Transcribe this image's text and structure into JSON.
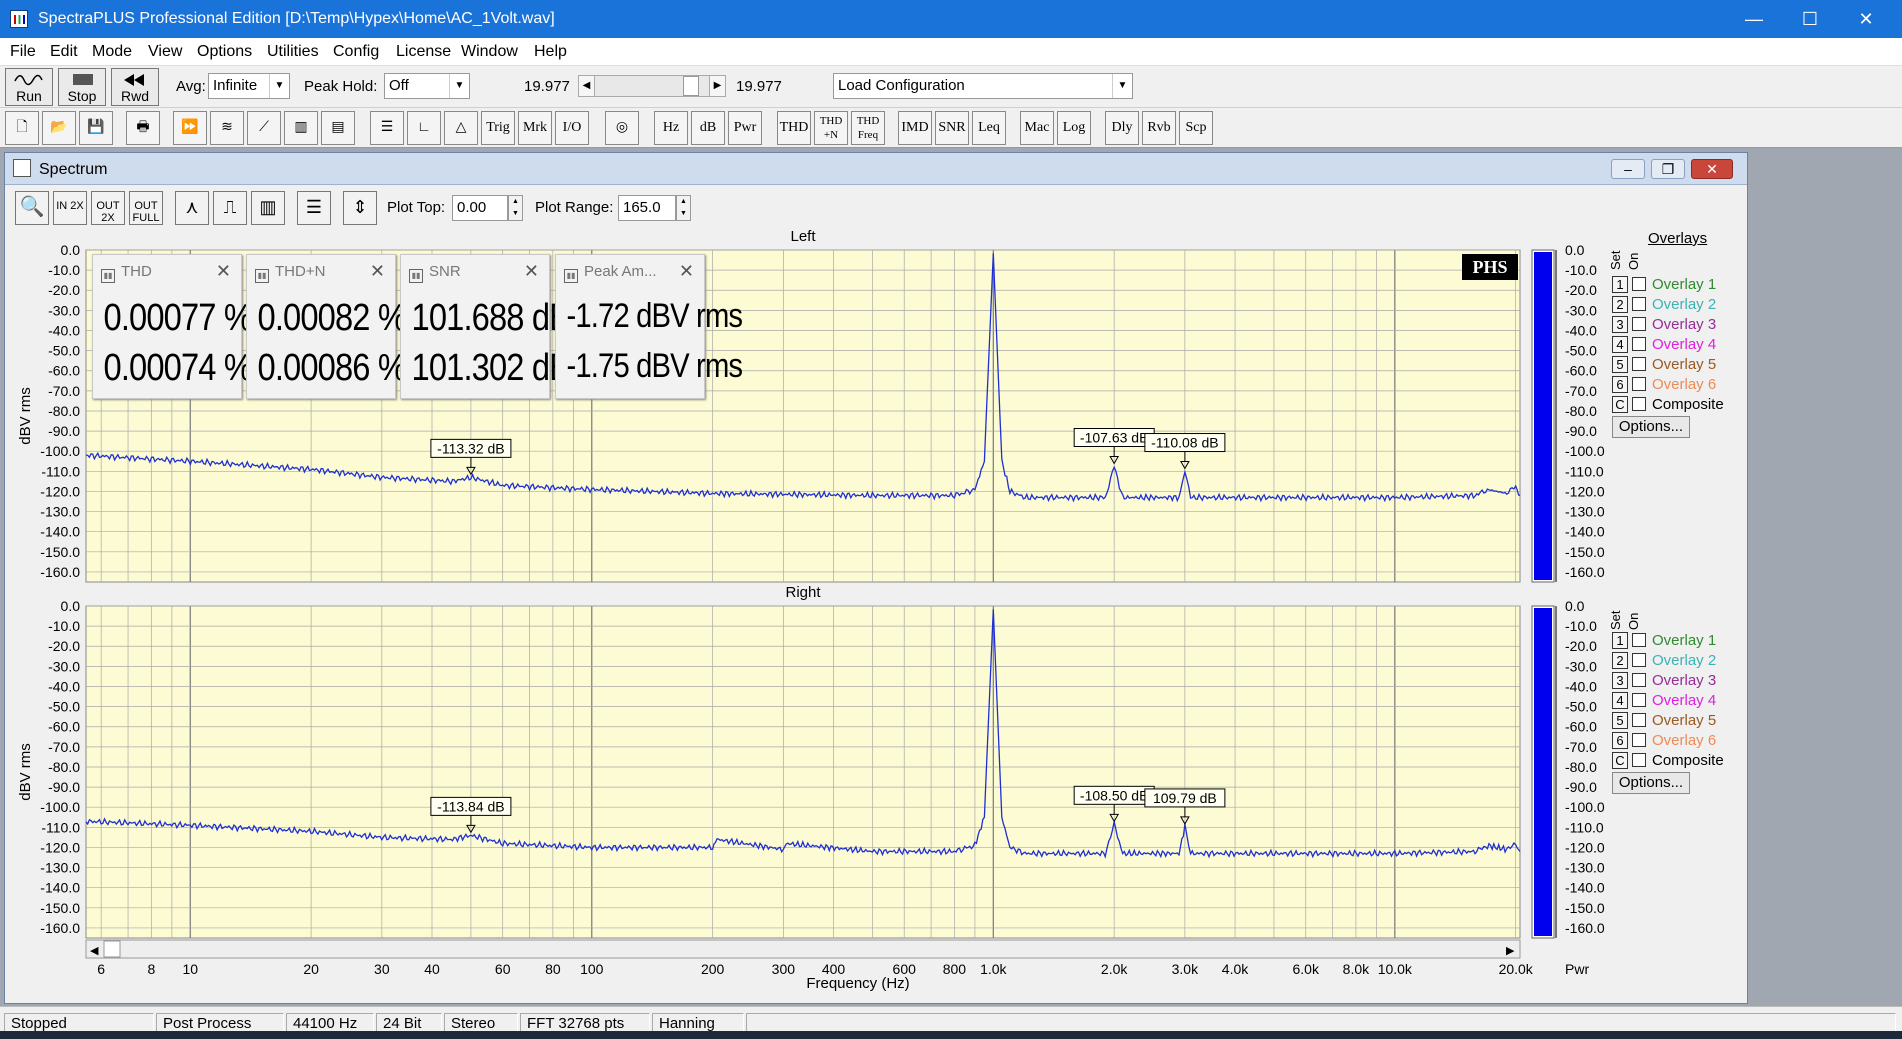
{
  "window": {
    "title": "SpectraPLUS Professional Edition [D:\\Temp\\Hypex\\Home\\AC_1Volt.wav]",
    "min": "—",
    "max": "☐",
    "close": "✕"
  },
  "menu": [
    "File",
    "Edit",
    "Mode",
    "View",
    "Options",
    "Utilities",
    "Config",
    "License",
    "Window",
    "Help"
  ],
  "toolbar1": {
    "run": "Run",
    "stop": "Stop",
    "rwd": "Rwd",
    "avg_label": "Avg:",
    "avg_value": "Infinite",
    "peakhold_label": "Peak Hold:",
    "peakhold_value": "Off",
    "time_left": "19.977",
    "time_right": "19.977",
    "config_value": "Load Configuration"
  },
  "toolbar2": [
    "Trig",
    "Mrk",
    "I/O",
    "Hz",
    "dB",
    "Pwr",
    "THD",
    "THD +N",
    "THD Freq",
    "IMD",
    "SNR",
    "Leq",
    "Mac",
    "Log",
    "Dly",
    "Rvb",
    "Scp"
  ],
  "spectrum": {
    "title": "Spectrum",
    "zoom": [
      "IN 2X",
      "OUT 2X",
      "OUT FULL"
    ],
    "plot_top_label": "Plot Top:",
    "plot_top_value": "0.00",
    "plot_range_label": "Plot Range:",
    "plot_range_value": "165.0",
    "logo": "PHS",
    "xlabel": "Frequency (Hz)",
    "xlabel_right": "Pwr"
  },
  "meters": [
    {
      "title": "THD",
      "left": "0.00077 %",
      "right": "0.00074 %"
    },
    {
      "title": "THD+N",
      "left": "0.00082 %",
      "right": "0.00086 %"
    },
    {
      "title": "SNR",
      "left": "101.688 dB",
      "right": "101.302 dB"
    },
    {
      "title": "Peak Am...",
      "left": "-1.72 dBV rms",
      "right": "-1.75 dBV rms"
    }
  ],
  "overlays": {
    "header": "Overlays",
    "set": "Set",
    "on": "On",
    "items": [
      {
        "n": "1",
        "label": "Overlay 1",
        "color": "#2e8b2e"
      },
      {
        "n": "2",
        "label": "Overlay 2",
        "color": "#3bb3b3"
      },
      {
        "n": "3",
        "label": "Overlay 3",
        "color": "#9a2a9a"
      },
      {
        "n": "4",
        "label": "Overlay 4",
        "color": "#e020e0"
      },
      {
        "n": "5",
        "label": "Overlay 5",
        "color": "#9a5a20"
      },
      {
        "n": "6",
        "label": "Overlay 6",
        "color": "#ee8a55"
      },
      {
        "n": "C",
        "label": "Composite",
        "color": "#000000"
      }
    ],
    "options": "Options..."
  },
  "chart_data": [
    {
      "type": "line",
      "title": "Left",
      "ylabel": "dBV rms",
      "xlabel": "Frequency (Hz)",
      "xscale": "log",
      "xlim": [
        5.5,
        20500
      ],
      "ylim": [
        -165,
        0
      ],
      "yticks": [
        "0.0",
        "-10.0",
        "-20.0",
        "-30.0",
        "-40.0",
        "-50.0",
        "-60.0",
        "-70.0",
        "-80.0",
        "-90.0",
        "-100.0",
        "-110.0",
        "-120.0",
        "-130.0",
        "-140.0",
        "-150.0",
        "-160.0"
      ],
      "xticks": [
        "6",
        "8",
        "10",
        "20",
        "30",
        "40",
        "60",
        "80",
        "100",
        "200",
        "300",
        "400",
        "600",
        "800",
        "1.0k",
        "2.0k",
        "3.0k",
        "4.0k",
        "6.0k",
        "8.0k",
        "10.0k",
        "20.0k"
      ],
      "series": [
        {
          "color": "#1f2fd0",
          "x": [
            5.5,
            10,
            20,
            30,
            45,
            50,
            60,
            100,
            200,
            500,
            800,
            900,
            950,
            1000,
            1050,
            1100,
            1200,
            1900,
            2000,
            2100,
            2900,
            3000,
            3100,
            10000,
            16000,
            17000,
            19000,
            20000,
            20500
          ],
          "y": [
            -102,
            -105,
            -109,
            -113,
            -115,
            -113,
            -117,
            -119,
            -121,
            -122,
            -122,
            -119,
            -105,
            -1.7,
            -105,
            -120,
            -123,
            -123,
            -107.6,
            -123,
            -123,
            -110.1,
            -123,
            -123,
            -122,
            -119,
            -121,
            -118,
            -122
          ]
        }
      ],
      "markers": [
        {
          "label": "-113.32 dB",
          "x": 50
        },
        {
          "label": "-107.63 dB",
          "x": 2000
        },
        {
          "label": "-110.08 dB",
          "x": 3000
        }
      ],
      "bar_level": 1.0
    },
    {
      "type": "line",
      "title": "Right",
      "ylabel": "dBV rms",
      "xlabel": "Frequency (Hz)",
      "xscale": "log",
      "xlim": [
        5.5,
        20500
      ],
      "ylim": [
        -165,
        0
      ],
      "yticks": [
        "0.0",
        "-10.0",
        "-20.0",
        "-30.0",
        "-40.0",
        "-50.0",
        "-60.0",
        "-70.0",
        "-80.0",
        "-90.0",
        "-100.0",
        "-110.0",
        "-120.0",
        "-130.0",
        "-140.0",
        "-150.0",
        "-160.0"
      ],
      "xticks": [
        "6",
        "8",
        "10",
        "20",
        "30",
        "40",
        "60",
        "80",
        "100",
        "200",
        "300",
        "400",
        "600",
        "800",
        "1.0k",
        "2.0k",
        "3.0k",
        "4.0k",
        "6.0k",
        "8.0k",
        "10.0k",
        "20.0k"
      ],
      "series": [
        {
          "color": "#1f2fd0",
          "x": [
            5.5,
            10,
            20,
            30,
            45,
            50,
            60,
            100,
            200,
            205,
            300,
            305,
            500,
            800,
            900,
            950,
            1000,
            1050,
            1100,
            1200,
            1900,
            2000,
            2100,
            2900,
            3000,
            3100,
            10000,
            16000,
            17000,
            19000,
            20000,
            20500
          ],
          "y": [
            -107,
            -109,
            -112,
            -115,
            -116,
            -114,
            -118,
            -120,
            -120,
            -116,
            -121,
            -118,
            -122,
            -122,
            -119,
            -105,
            -1.7,
            -105,
            -120,
            -123,
            -123,
            -108.5,
            -123,
            -123,
            -109.8,
            -123,
            -123,
            -122,
            -119,
            -121,
            -119,
            -122
          ]
        }
      ],
      "markers": [
        {
          "label": "-113.84 dB",
          "x": 50
        },
        {
          "label": "-108.50 dB",
          "x": 2000
        },
        {
          "label": "109.79 dB",
          "x": 3000
        }
      ],
      "bar_level": 1.0
    }
  ],
  "statusbar": [
    "Stopped",
    "Post Process",
    "44100 Hz",
    "24 Bit",
    "Stereo",
    "FFT 32768 pts",
    "Hanning"
  ]
}
